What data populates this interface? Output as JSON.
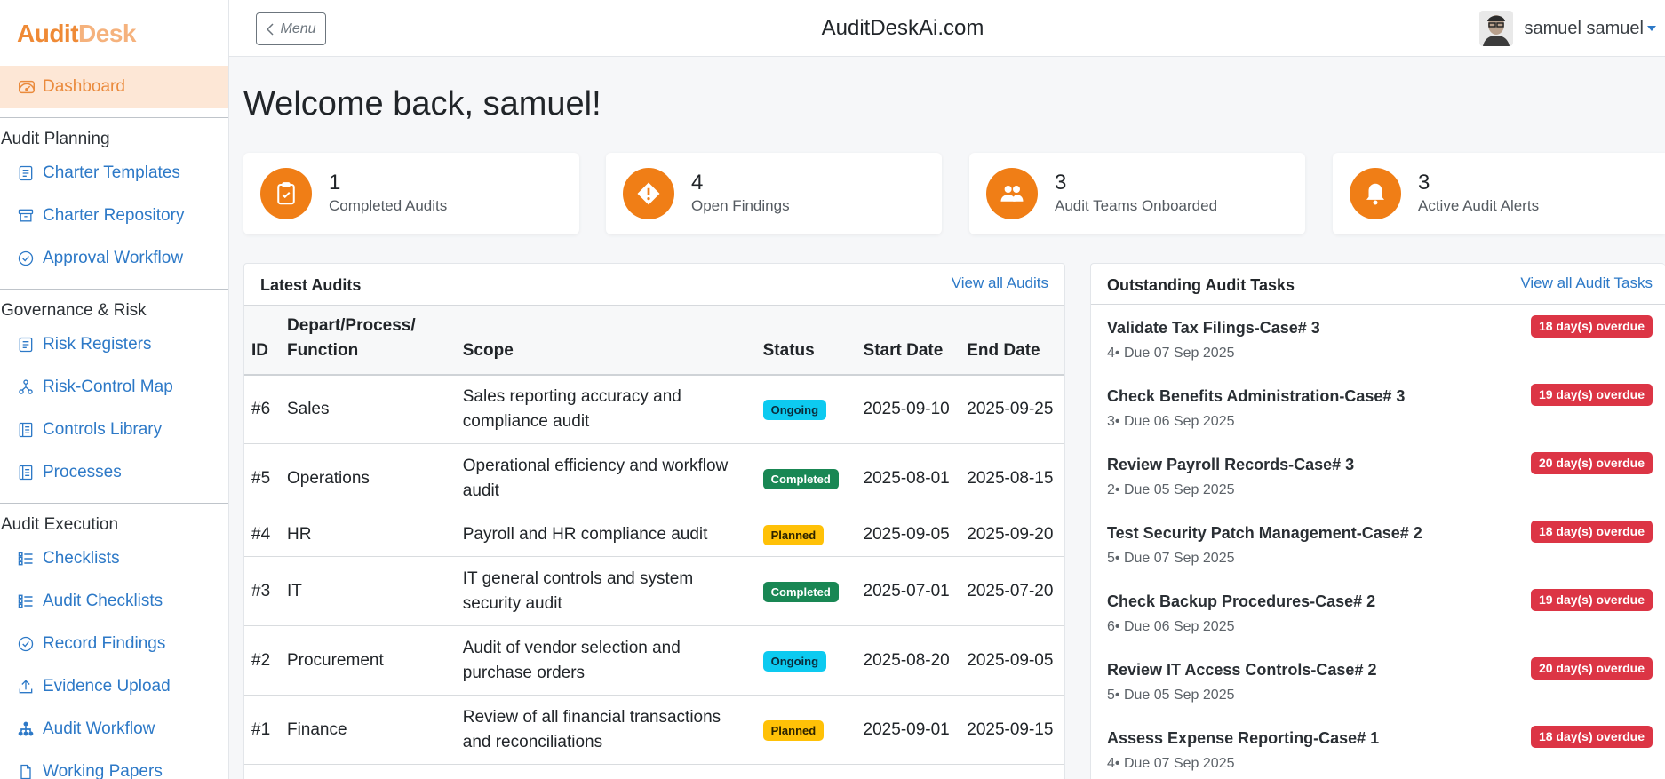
{
  "brand": {
    "part1": "Audit",
    "part2": "Desk",
    "accent": "#ef8a36"
  },
  "sidebar": {
    "active": {
      "label": "Dashboard",
      "icon": "dashboard-gauge-icon"
    },
    "sections": [
      {
        "title": "Audit Planning",
        "items": [
          {
            "label": "Charter Templates",
            "icon": "list-document-icon"
          },
          {
            "label": "Charter Repository",
            "icon": "archive-box-icon"
          },
          {
            "label": "Approval Workflow",
            "icon": "check-circle-icon"
          }
        ]
      },
      {
        "title": "Governance & Risk",
        "items": [
          {
            "label": "Risk Registers",
            "icon": "list-document-icon"
          },
          {
            "label": "Risk-Control Map",
            "icon": "diagram-icon"
          },
          {
            "label": "Controls Library",
            "icon": "book-icon"
          },
          {
            "label": "Processes",
            "icon": "book-icon"
          }
        ]
      },
      {
        "title": "Audit Execution",
        "items": [
          {
            "label": "Checklists",
            "icon": "checklist-icon"
          },
          {
            "label": "Audit Checklists",
            "icon": "checklist-icon"
          },
          {
            "label": "Record Findings",
            "icon": "check-circle-icon"
          },
          {
            "label": "Evidence Upload",
            "icon": "upload-icon"
          },
          {
            "label": "Audit Workflow",
            "icon": "workflow-icon"
          },
          {
            "label": "Working Papers",
            "icon": "document-icon"
          }
        ]
      }
    ]
  },
  "topbar": {
    "menu_label": "Menu",
    "site_title": "AuditDeskAi.com",
    "username": "samuel samuel"
  },
  "welcome": "Welcome back, samuel!",
  "stats": [
    {
      "value": "1",
      "label": "Completed Audits",
      "icon": "clipboard-check-icon"
    },
    {
      "value": "4",
      "label": "Open Findings",
      "icon": "warning-diamond-icon"
    },
    {
      "value": "3",
      "label": "Audit Teams Onboarded",
      "icon": "people-icon"
    },
    {
      "value": "3",
      "label": "Active Audit Alerts",
      "icon": "bell-icon"
    }
  ],
  "latest_audits": {
    "title": "Latest Audits",
    "link": "View all Audits",
    "columns": [
      "ID",
      "Depart/Process/ Function",
      "Scope",
      "Status",
      "Start Date",
      "End Date"
    ],
    "rows": [
      {
        "id": "#6",
        "dept": "Sales",
        "scope": "Sales reporting accuracy and compliance audit",
        "status": "Ongoing",
        "start": "2025-09-10",
        "end": "2025-09-25"
      },
      {
        "id": "#5",
        "dept": "Operations",
        "scope": "Operational efficiency and workflow audit",
        "status": "Completed",
        "start": "2025-08-01",
        "end": "2025-08-15"
      },
      {
        "id": "#4",
        "dept": "HR",
        "scope": "Payroll and HR compliance audit",
        "status": "Planned",
        "start": "2025-09-05",
        "end": "2025-09-20"
      },
      {
        "id": "#3",
        "dept": "IT",
        "scope": "IT general controls and system security audit",
        "status": "Completed",
        "start": "2025-07-01",
        "end": "2025-07-20"
      },
      {
        "id": "#2",
        "dept": "Procurement",
        "scope": "Audit of vendor selection and purchase orders",
        "status": "Ongoing",
        "start": "2025-08-20",
        "end": "2025-09-05"
      },
      {
        "id": "#1",
        "dept": "Finance",
        "scope": "Review of all financial transactions and reconciliations",
        "status": "Planned",
        "start": "2025-09-01",
        "end": "2025-09-15"
      }
    ]
  },
  "tasks": {
    "title": "Outstanding Audit Tasks",
    "link": "View all Audit Tasks",
    "items": [
      {
        "title": "Validate Tax Filings-Case# 3",
        "meta": "4• Due 07 Sep 2025",
        "badge": "18 day(s) overdue"
      },
      {
        "title": "Check Benefits Administration-Case# 3",
        "meta": "3• Due 06 Sep 2025",
        "badge": "19 day(s) overdue"
      },
      {
        "title": "Review Payroll Records-Case# 3",
        "meta": "2• Due 05 Sep 2025",
        "badge": "20 day(s) overdue"
      },
      {
        "title": "Test Security Patch Management-Case# 2",
        "meta": "5• Due 07 Sep 2025",
        "badge": "18 day(s) overdue"
      },
      {
        "title": "Check Backup Procedures-Case# 2",
        "meta": "6• Due 06 Sep 2025",
        "badge": "19 day(s) overdue"
      },
      {
        "title": "Review IT Access Controls-Case# 2",
        "meta": "5• Due 05 Sep 2025",
        "badge": "20 day(s) overdue"
      },
      {
        "title": "Assess Expense Reporting-Case# 1",
        "meta": "4• Due 07 Sep 2025",
        "badge": "18 day(s) overdue"
      }
    ]
  }
}
